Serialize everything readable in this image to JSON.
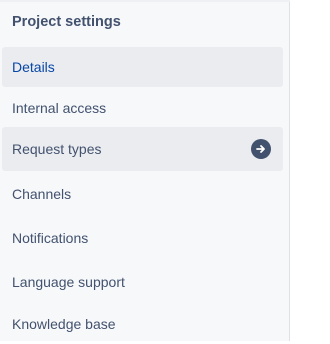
{
  "sidebar": {
    "section_title": "Project settings",
    "items": [
      {
        "label": "Details",
        "state": "selected"
      },
      {
        "label": "Internal access"
      },
      {
        "label": "Request types",
        "state": "hovered",
        "trailing_icon": "arrow-right-circle-icon"
      },
      {
        "label": "Channels"
      },
      {
        "label": "Notifications"
      },
      {
        "label": "Language support"
      },
      {
        "label": "Knowledge base"
      }
    ]
  },
  "colors": {
    "sidebar_bg": "#f7f8fa",
    "selected_bg": "#ebecf0",
    "selected_text": "#0747a6",
    "text": "#42526e",
    "divider": "#dfe1e6"
  }
}
